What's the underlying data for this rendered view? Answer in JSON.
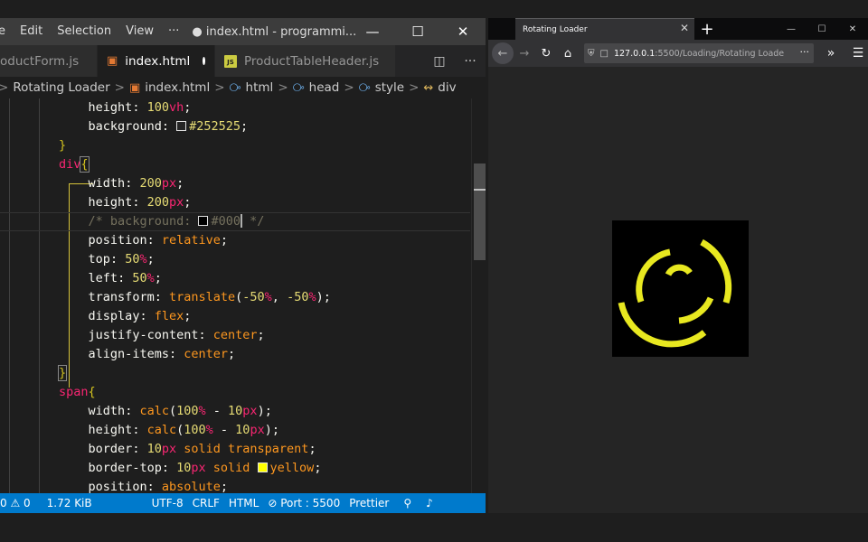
{
  "vscode": {
    "menu": [
      "e",
      "Edit",
      "Selection",
      "View",
      "···"
    ],
    "window_title": "● index.html - programmi...",
    "window_controls": [
      "—",
      "☐",
      "✕"
    ],
    "tabs": [
      {
        "label": "oductForm.js"
      },
      {
        "label": "index.html",
        "active": true
      },
      {
        "label": "ProductTableHeader.js"
      }
    ],
    "breadcrumbs": [
      "Rotating Loader",
      "index.html",
      "html",
      "head",
      "style",
      "div"
    ],
    "statusbar": {
      "problems": "0 ⚠ 0",
      "size": "1.72 KiB",
      "encoding": "UTF-8",
      "eol": "CRLF",
      "language": "HTML",
      "port": "Port : 5500",
      "formatter": "Prettier"
    }
  },
  "code": {
    "l1_prop": "height",
    "l1_num": "100",
    "l1_unit": "vh",
    "l2_prop": "background",
    "l2_val": "#252525",
    "l4_sel": "div",
    "l5_prop": "width",
    "l5_num": "200",
    "l5_unit": "px",
    "l6_prop": "height",
    "l6_num": "200",
    "l6_unit": "px",
    "l7_a": "/* background: ",
    "l7_b": "#000",
    "l7_c": " */",
    "l8_prop": "position",
    "l8_val": "relative",
    "l9_prop": "top",
    "l9_num": "50",
    "l9_unit": "%",
    "l10_prop": "left",
    "l10_num": "50",
    "l10_unit": "%",
    "l11_prop": "transform",
    "l11_fn": "translate",
    "l11_n1": "-50",
    "l11_n2": "-50",
    "l12_prop": "display",
    "l12_val": "flex",
    "l13_prop": "justify-content",
    "l13_val": "center",
    "l14_prop": "align-items",
    "l14_val": "center",
    "l16_sel": "span",
    "l17_prop": "width",
    "l17_fn": "calc",
    "l17_n1": "100",
    "l17_n2": "10",
    "l18_prop": "height",
    "l18_fn": "calc",
    "l18_n1": "100",
    "l18_n2": "10",
    "l19_prop": "border",
    "l19_n": "10",
    "l19_val": "solid transparent",
    "l20_prop": "border-top",
    "l20_n": "10",
    "l20_val1": "solid",
    "l20_val2": "yellow",
    "l21_prop": "position",
    "l21_val": "absolute"
  },
  "colors": {
    "swatch_dark": "#252525",
    "swatch_black": "#000000",
    "swatch_yellow": "#ffff00",
    "loader": "#e8e820"
  },
  "firefox": {
    "tab_title": "Rotating Loader",
    "url_host": "127.0.0.1",
    "url_path": ":5500/Loading/Rotating Loade",
    "window_controls": [
      "—",
      "☐",
      "✕"
    ]
  }
}
